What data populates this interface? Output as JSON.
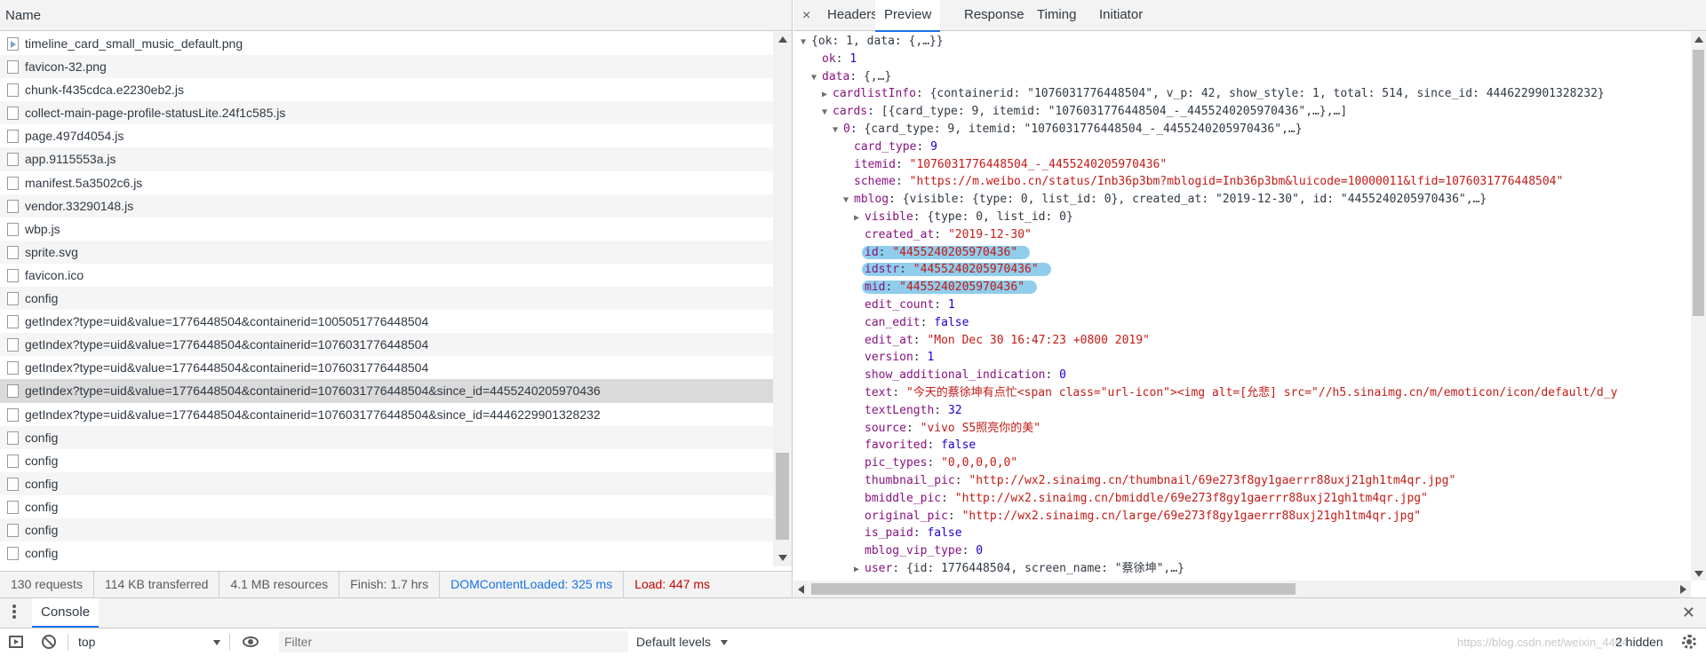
{
  "network": {
    "name_header": "Name",
    "requests": [
      {
        "name": "timeline_card_small_music_default.png",
        "icon": "image-file-icon"
      },
      {
        "name": "favicon-32.png",
        "icon": "file-icon"
      },
      {
        "name": "chunk-f435cdca.e2230eb2.js",
        "icon": "file-icon"
      },
      {
        "name": "collect-main-page-profile-statusLite.24f1c585.js",
        "icon": "file-icon"
      },
      {
        "name": "page.497d4054.js",
        "icon": "file-icon"
      },
      {
        "name": "app.9115553a.js",
        "icon": "file-icon"
      },
      {
        "name": "manifest.5a3502c6.js",
        "icon": "file-icon"
      },
      {
        "name": "vendor.33290148.js",
        "icon": "file-icon"
      },
      {
        "name": "wbp.js",
        "icon": "file-icon"
      },
      {
        "name": "sprite.svg",
        "icon": "file-icon"
      },
      {
        "name": "favicon.ico",
        "icon": "file-icon"
      },
      {
        "name": "config",
        "icon": "file-icon"
      },
      {
        "name": "getIndex?type=uid&value=1776448504&containerid=1005051776448504",
        "icon": "file-icon"
      },
      {
        "name": "getIndex?type=uid&value=1776448504&containerid=1076031776448504",
        "icon": "file-icon"
      },
      {
        "name": "getIndex?type=uid&value=1776448504&containerid=1076031776448504",
        "icon": "file-icon"
      },
      {
        "name": "getIndex?type=uid&value=1776448504&containerid=1076031776448504&since_id=4455240205970436",
        "icon": "file-icon",
        "selected": true
      },
      {
        "name": "getIndex?type=uid&value=1776448504&containerid=1076031776448504&since_id=4446229901328232",
        "icon": "file-icon"
      },
      {
        "name": "config",
        "icon": "file-icon"
      },
      {
        "name": "config",
        "icon": "file-icon"
      },
      {
        "name": "config",
        "icon": "file-icon"
      },
      {
        "name": "config",
        "icon": "file-icon"
      },
      {
        "name": "config",
        "icon": "file-icon"
      },
      {
        "name": "config",
        "icon": "file-icon"
      }
    ],
    "summary": {
      "requests": "130 requests",
      "transferred": "114 KB transferred",
      "resources": "4.1 MB resources",
      "finish": "Finish: 1.7 hrs",
      "dom_content_loaded": "DOMContentLoaded: 325 ms",
      "load": "Load: 447 ms"
    }
  },
  "preview": {
    "close": "×",
    "tabs": [
      "Headers",
      "Preview",
      "Response",
      "Timing",
      "Initiator"
    ],
    "active_tab": "Preview",
    "lines": [
      {
        "depth": 0,
        "tri": "▼",
        "parts": [
          [
            "",
            "{ok: 1, data: {,…}}"
          ]
        ]
      },
      {
        "depth": 1,
        "tri": "",
        "parts": [
          [
            "k",
            "ok"
          ],
          [
            "",
            ": "
          ],
          [
            "n",
            "1"
          ]
        ]
      },
      {
        "depth": 1,
        "tri": "▼",
        "parts": [
          [
            "k",
            "data"
          ],
          [
            "",
            ": {,…}"
          ]
        ]
      },
      {
        "depth": 2,
        "tri": "▶",
        "parts": [
          [
            "k",
            "cardlistInfo"
          ],
          [
            "",
            ": {containerid: \"1076031776448504\", v_p: 42, show_style: 1, total: 514, since_id: 4446229901328232}"
          ]
        ]
      },
      {
        "depth": 2,
        "tri": "▼",
        "parts": [
          [
            "k",
            "cards"
          ],
          [
            "",
            ": [{card_type: 9, itemid: \"1076031776448504_-_4455240205970436\",…},…]"
          ]
        ]
      },
      {
        "depth": 3,
        "tri": "▼",
        "parts": [
          [
            "k",
            "0"
          ],
          [
            "",
            ": {card_type: 9, itemid: \"1076031776448504_-_4455240205970436\",…}"
          ]
        ]
      },
      {
        "depth": 4,
        "tri": "",
        "parts": [
          [
            "k",
            "card_type"
          ],
          [
            "",
            ": "
          ],
          [
            "n",
            "9"
          ]
        ]
      },
      {
        "depth": 4,
        "tri": "",
        "parts": [
          [
            "k",
            "itemid"
          ],
          [
            "",
            ": "
          ],
          [
            "s",
            "\"1076031776448504_-_4455240205970436\""
          ]
        ]
      },
      {
        "depth": 4,
        "tri": "",
        "parts": [
          [
            "k",
            "scheme"
          ],
          [
            "",
            ": "
          ],
          [
            "s",
            "\"https://m.weibo.cn/status/Inb36p3bm?mblogid=Inb36p3bm&luicode=10000011&lfid=1076031776448504\""
          ]
        ]
      },
      {
        "depth": 4,
        "tri": "▼",
        "parts": [
          [
            "k",
            "mblog"
          ],
          [
            "",
            ": {visible: {type: 0, list_id: 0}, created_at: \"2019-12-30\", id: \"4455240205970436\",…}"
          ]
        ]
      },
      {
        "depth": 5,
        "tri": "▶",
        "parts": [
          [
            "k",
            "visible"
          ],
          [
            "",
            ": {type: 0, list_id: 0}"
          ]
        ]
      },
      {
        "depth": 5,
        "tri": "",
        "parts": [
          [
            "k",
            "created_at"
          ],
          [
            "",
            ": "
          ],
          [
            "s",
            "\"2019-12-30\""
          ]
        ]
      },
      {
        "depth": 5,
        "tri": "",
        "highlight": true,
        "parts": [
          [
            "k",
            "id"
          ],
          [
            "",
            ": "
          ],
          [
            "s",
            "\"4455240205970436\""
          ]
        ]
      },
      {
        "depth": 5,
        "tri": "",
        "highlight": true,
        "parts": [
          [
            "k",
            "idstr"
          ],
          [
            "",
            ": "
          ],
          [
            "s",
            "\"4455240205970436\""
          ]
        ]
      },
      {
        "depth": 5,
        "tri": "",
        "highlight": true,
        "parts": [
          [
            "k",
            "mid"
          ],
          [
            "",
            ": "
          ],
          [
            "s",
            "\"4455240205970436\""
          ]
        ]
      },
      {
        "depth": 5,
        "tri": "",
        "parts": [
          [
            "k",
            "edit_count"
          ],
          [
            "",
            ": "
          ],
          [
            "n",
            "1"
          ]
        ]
      },
      {
        "depth": 5,
        "tri": "",
        "parts": [
          [
            "k",
            "can_edit"
          ],
          [
            "",
            ": "
          ],
          [
            "n",
            "false"
          ]
        ]
      },
      {
        "depth": 5,
        "tri": "",
        "parts": [
          [
            "k",
            "edit_at"
          ],
          [
            "",
            ": "
          ],
          [
            "s",
            "\"Mon Dec 30 16:47:23 +0800 2019\""
          ]
        ]
      },
      {
        "depth": 5,
        "tri": "",
        "parts": [
          [
            "k",
            "version"
          ],
          [
            "",
            ": "
          ],
          [
            "n",
            "1"
          ]
        ]
      },
      {
        "depth": 5,
        "tri": "",
        "parts": [
          [
            "k",
            "show_additional_indication"
          ],
          [
            "",
            ": "
          ],
          [
            "n",
            "0"
          ]
        ]
      },
      {
        "depth": 5,
        "tri": "",
        "parts": [
          [
            "k",
            "text"
          ],
          [
            "",
            ": "
          ],
          [
            "s",
            "\"今天的蔡徐坤有点忙<span class=\"url-icon\"><img alt=[允悲] src=\"//h5.sinaimg.cn/m/emoticon/icon/default/d_y"
          ]
        ]
      },
      {
        "depth": 5,
        "tri": "",
        "parts": [
          [
            "k",
            "textLength"
          ],
          [
            "",
            ": "
          ],
          [
            "n",
            "32"
          ]
        ]
      },
      {
        "depth": 5,
        "tri": "",
        "parts": [
          [
            "k",
            "source"
          ],
          [
            "",
            ": "
          ],
          [
            "s",
            "\"vivo S5照亮你的美\""
          ]
        ]
      },
      {
        "depth": 5,
        "tri": "",
        "parts": [
          [
            "k",
            "favorited"
          ],
          [
            "",
            ": "
          ],
          [
            "n",
            "false"
          ]
        ]
      },
      {
        "depth": 5,
        "tri": "",
        "parts": [
          [
            "k",
            "pic_types"
          ],
          [
            "",
            ": "
          ],
          [
            "s",
            "\"0,0,0,0,0\""
          ]
        ]
      },
      {
        "depth": 5,
        "tri": "",
        "parts": [
          [
            "k",
            "thumbnail_pic"
          ],
          [
            "",
            ": "
          ],
          [
            "s",
            "\"http://wx2.sinaimg.cn/thumbnail/69e273f8gy1gaerrr88uxj21gh1tm4qr.jpg\""
          ]
        ]
      },
      {
        "depth": 5,
        "tri": "",
        "parts": [
          [
            "k",
            "bmiddle_pic"
          ],
          [
            "",
            ": "
          ],
          [
            "s",
            "\"http://wx2.sinaimg.cn/bmiddle/69e273f8gy1gaerrr88uxj21gh1tm4qr.jpg\""
          ]
        ]
      },
      {
        "depth": 5,
        "tri": "",
        "parts": [
          [
            "k",
            "original_pic"
          ],
          [
            "",
            ": "
          ],
          [
            "s",
            "\"http://wx2.sinaimg.cn/large/69e273f8gy1gaerrr88uxj21gh1tm4qr.jpg\""
          ]
        ]
      },
      {
        "depth": 5,
        "tri": "",
        "parts": [
          [
            "k",
            "is_paid"
          ],
          [
            "",
            ": "
          ],
          [
            "n",
            "false"
          ]
        ]
      },
      {
        "depth": 5,
        "tri": "",
        "parts": [
          [
            "k",
            "mblog_vip_type"
          ],
          [
            "",
            ": "
          ],
          [
            "n",
            "0"
          ]
        ]
      },
      {
        "depth": 5,
        "tri": "▶",
        "parts": [
          [
            "k",
            "user"
          ],
          [
            "",
            ": {id: 1776448504, screen_name: \"蔡徐坤\",…}"
          ]
        ]
      }
    ]
  },
  "drawer": {
    "console_tab": "Console",
    "close": "✕",
    "context": "top",
    "filter_placeholder": "Filter",
    "levels": "Default levels",
    "watermark": "https://blog.csdn.net/weixin_4404",
    "hidden": "2 hidden"
  },
  "colors": {
    "accent": "#1a73e8",
    "json_key": "#881280",
    "json_string": "#c41a16",
    "json_number": "#1c00cf",
    "highlight": "#8fcdeb",
    "selected_row": "#dadada"
  }
}
